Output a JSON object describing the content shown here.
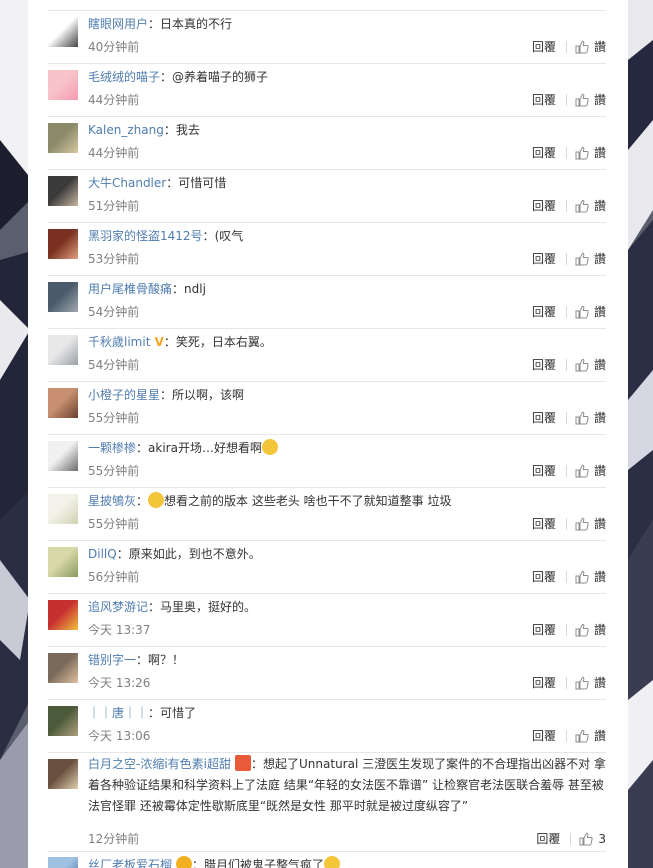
{
  "colors": {
    "username": "#507daf",
    "meta": "#808080",
    "text": "#333333",
    "divider": "#e6e6e6"
  },
  "actions": {
    "reply": "回覆",
    "like": "讚"
  },
  "comments": [
    {
      "user": "瞎眼网用户",
      "text": "日本真的不行",
      "time": "40分钟前",
      "likes": "讚"
    },
    {
      "user": "毛绒绒的喵子",
      "text": "@养着喵子的狮子",
      "time": "44分钟前",
      "likes": "讚"
    },
    {
      "user": "Kalen_zhang",
      "text": "我去",
      "time": "44分钟前",
      "likes": "讚"
    },
    {
      "user": "大牛Chandler",
      "text": "可惜可惜",
      "time": "51分钟前",
      "likes": "讚"
    },
    {
      "user": "黑羽家的怪盗1412号",
      "text": "(叹气",
      "time": "53分钟前",
      "likes": "讚"
    },
    {
      "user": "用户尾椎骨酸痛",
      "text": "ndlj",
      "time": "54分钟前",
      "likes": "讚"
    },
    {
      "user": "千秋歲limit",
      "text": "笑死，日本右翼。",
      "time": "54分钟前",
      "likes": "讚"
    },
    {
      "user": "小橙子的星星",
      "text": "所以啊，该啊",
      "time": "55分钟前",
      "likes": "讚"
    },
    {
      "user": "一颗椮椮",
      "text": "akira开场…好想看啊",
      "time": "55分钟前",
      "likes": "讚"
    },
    {
      "user": "星披鴝灰",
      "text": "想看之前的版本 这些老头 啥也干不了就知道整事 垃圾",
      "time": "55分钟前",
      "likes": "讚"
    },
    {
      "user": "DillQ",
      "text": "原来如此，到也不意外。",
      "time": "56分钟前",
      "likes": "讚"
    },
    {
      "user": "追风梦游记",
      "text": "马里奥，挺好的。",
      "time": "今天 13:37",
      "likes": "讚"
    },
    {
      "user": "错别字一",
      "text": "啊？！",
      "time": "今天 13:26",
      "likes": "讚"
    },
    {
      "user": "｜｜唐｜｜",
      "text": "可惜了",
      "time": "今天 13:06",
      "likes": "讚"
    },
    {
      "user": "白月之空-浓缩i有色素i超甜",
      "text": "想起了Unnatural 三澄医生发现了案件的不合理指出凶器不对 拿着各种验证结果和科学资料上了法庭 结果“年轻的女法医不靠谱” 让检察官老法医联合羞辱 甚至被法官怪罪 还被霉体定性歇斯底里“既然是女性 那平时就是被过度纵容了”",
      "time": "12分钟前",
      "likes": "3"
    },
    {
      "user": "丝厂老板爱石榴",
      "text": "腊月们被鬼子整气疯了",
      "time": ""
    }
  ]
}
